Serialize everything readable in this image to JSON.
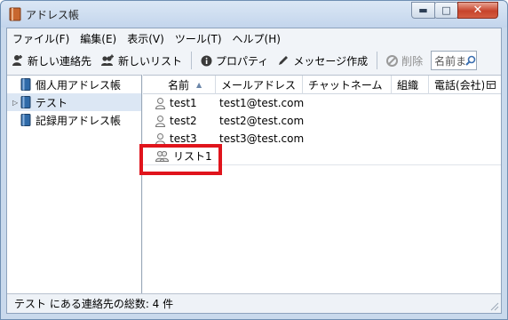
{
  "window": {
    "title": "アドレス帳",
    "minimize_glyph": "▬",
    "maximize_glyph": "□",
    "close_glyph": "✕"
  },
  "menu": [
    {
      "label": "ファイル(F)"
    },
    {
      "label": "編集(E)"
    },
    {
      "label": "表示(V)"
    },
    {
      "label": "ツール(T)"
    },
    {
      "label": "ヘルプ(H)"
    }
  ],
  "toolbar": {
    "new_contact": "新しい連絡先",
    "new_list": "新しいリスト",
    "properties": "プロパティ",
    "compose": "メッセージ作成",
    "delete": "削除",
    "search_placeholder": "名前また"
  },
  "sidebar": {
    "items": [
      {
        "label": "個人用アドレス帳",
        "icon": "address-book-icon",
        "selected": false,
        "expandable": false
      },
      {
        "label": "テスト",
        "icon": "address-book-icon",
        "selected": true,
        "expandable": true
      },
      {
        "label": "記録用アドレス帳",
        "icon": "address-book-icon",
        "selected": false,
        "expandable": false
      }
    ]
  },
  "columns": {
    "name": "名前",
    "email": "メールアドレス",
    "chat": "チャットネーム",
    "org": "組織",
    "phone": "電話(会社)"
  },
  "rows": [
    {
      "name": "test1",
      "email": "test1@test.com",
      "icon": "contact-icon"
    },
    {
      "name": "test2",
      "email": "test2@test.com",
      "icon": "contact-icon"
    },
    {
      "name": "test3",
      "email": "test3@test.com",
      "icon": "contact-icon"
    },
    {
      "name": "リスト1",
      "email": "",
      "icon": "mailing-list-icon"
    }
  ],
  "status": {
    "text": "テスト にある連絡先の総数: 4 件"
  },
  "colors": {
    "highlight": "#e0141c",
    "selection": "#dce7f4"
  }
}
